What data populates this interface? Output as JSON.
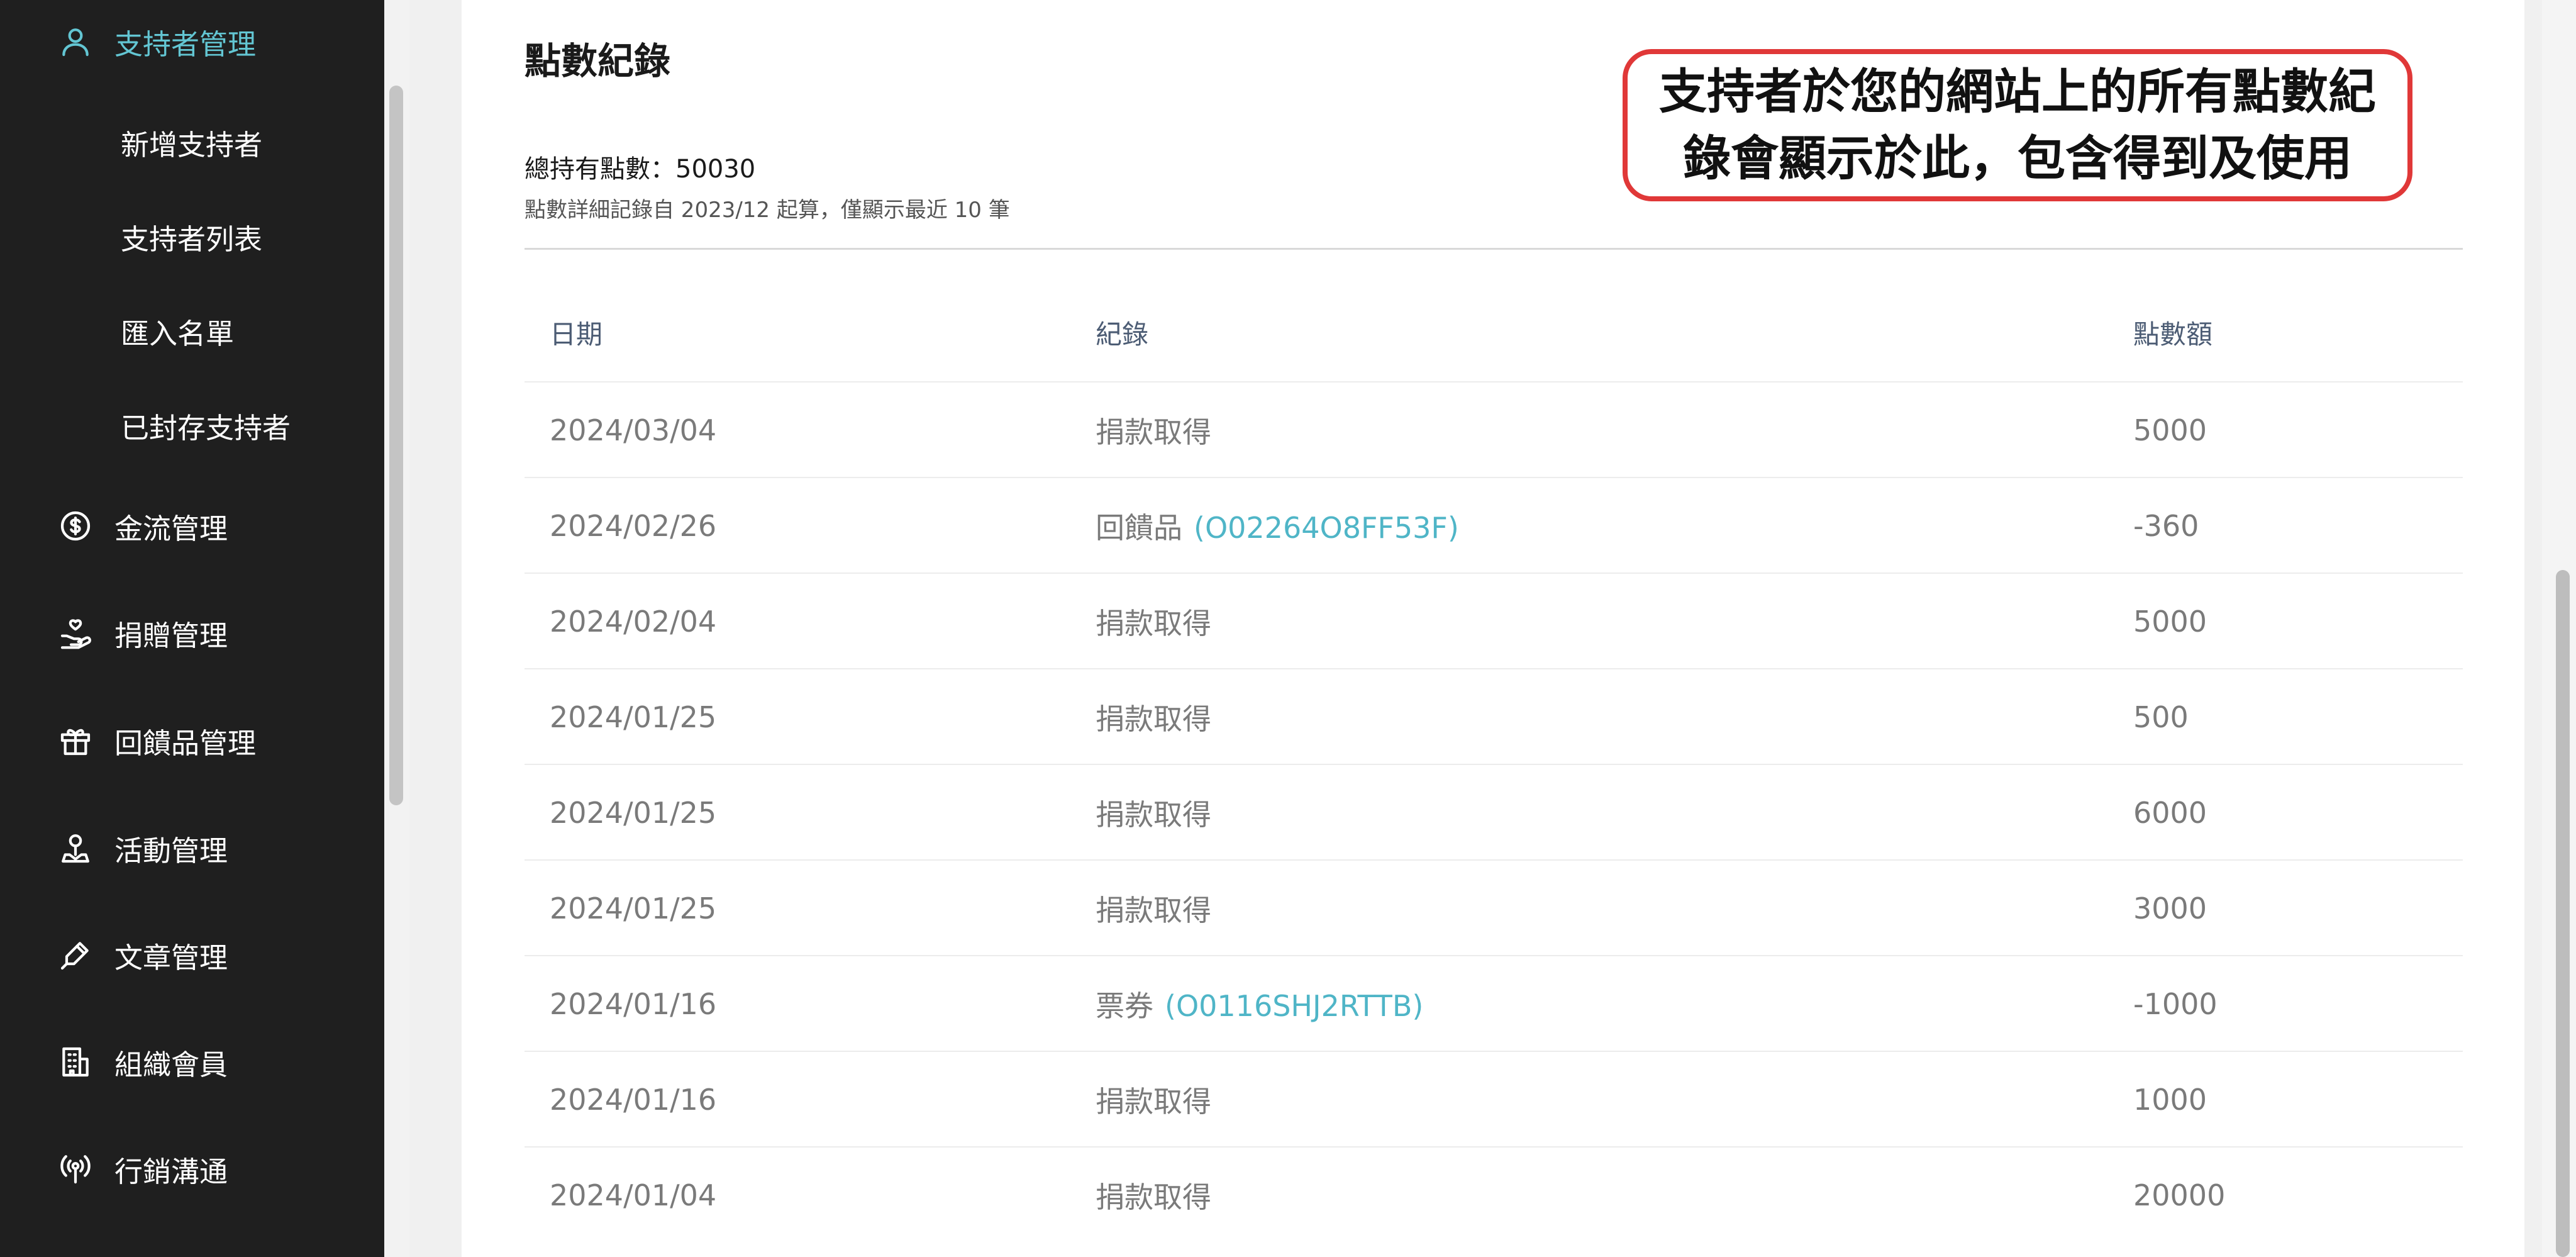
{
  "sidebar": {
    "active": {
      "label": "支持者管理",
      "icon": "person-icon"
    },
    "sub_items": [
      {
        "label": "新增支持者"
      },
      {
        "label": "支持者列表"
      },
      {
        "label": "匯入名單"
      },
      {
        "label": "已封存支持者"
      }
    ],
    "items": [
      {
        "label": "金流管理",
        "icon": "dollar-icon"
      },
      {
        "label": "捐贈管理",
        "icon": "donation-hand-icon"
      },
      {
        "label": "回饋品管理",
        "icon": "gift-icon"
      },
      {
        "label": "活動管理",
        "icon": "pin-icon"
      },
      {
        "label": "文章管理",
        "icon": "pen-icon"
      },
      {
        "label": "組織會員",
        "icon": "building-icon"
      },
      {
        "label": "行銷溝通",
        "icon": "broadcast-icon"
      }
    ]
  },
  "main": {
    "title": "點數紀錄",
    "total_points": "總持有點數：50030",
    "note": "點數詳細記錄自 2023/12 起算，僅顯示最近 10 筆",
    "callout": "支持者於您的網站上的所有點數紀錄會顯示於此，包含得到及使用",
    "columns": [
      "日期",
      "紀錄",
      "點數額"
    ],
    "rows": [
      {
        "date": "2024/03/04",
        "record": "捐款取得",
        "code": "",
        "amount": "5000"
      },
      {
        "date": "2024/02/26",
        "record": "回饋品",
        "code": "(O02264O8FF53F)",
        "amount": "-360"
      },
      {
        "date": "2024/02/04",
        "record": "捐款取得",
        "code": "",
        "amount": "5000"
      },
      {
        "date": "2024/01/25",
        "record": "捐款取得",
        "code": "",
        "amount": "500"
      },
      {
        "date": "2024/01/25",
        "record": "捐款取得",
        "code": "",
        "amount": "6000"
      },
      {
        "date": "2024/01/25",
        "record": "捐款取得",
        "code": "",
        "amount": "3000"
      },
      {
        "date": "2024/01/16",
        "record": "票券",
        "code": "(O0116SHJ2RTTB)",
        "amount": "-1000"
      },
      {
        "date": "2024/01/16",
        "record": "捐款取得",
        "code": "",
        "amount": "1000"
      },
      {
        "date": "2024/01/04",
        "record": "捐款取得",
        "code": "",
        "amount": "20000"
      }
    ]
  },
  "colors": {
    "sidebar_bg": "#1f1f1f",
    "accent": "#63c6d3",
    "link": "#4fb5c7",
    "callout_border": "#e03838"
  }
}
